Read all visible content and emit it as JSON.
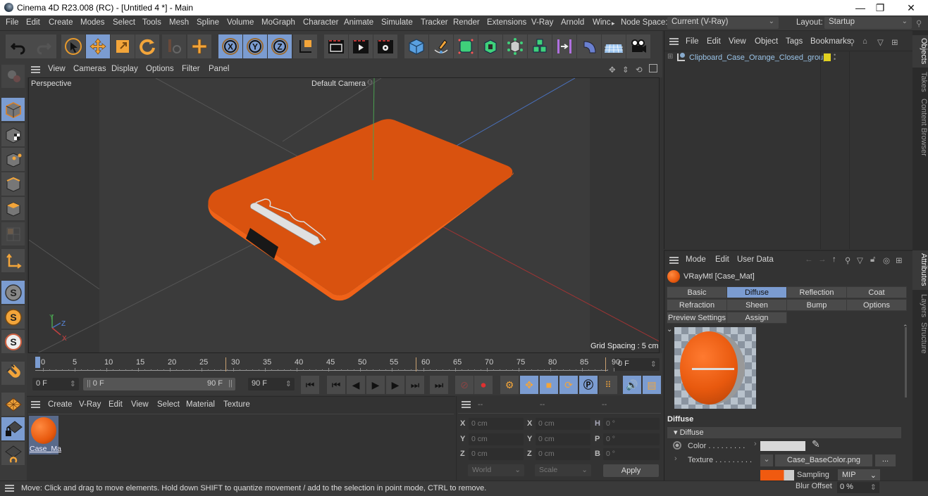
{
  "window": {
    "title": "Cinema 4D R23.008 (RC) - [Untitled 4 *] - Main",
    "minimize": "—",
    "restore": "❐",
    "close": "✕"
  },
  "menubar": {
    "items": [
      "File",
      "Edit",
      "Create",
      "Modes",
      "Select",
      "Tools",
      "Mesh",
      "Spline",
      "Volume",
      "MoGraph",
      "Character",
      "Animate",
      "Simulate",
      "Tracker",
      "Render",
      "Extensions",
      "V-Ray",
      "Arnold",
      "Winc"
    ],
    "more_arrow": "▸",
    "node_space_label": "Node Space:",
    "node_space_value": "Current (V-Ray)",
    "layout_label": "Layout:",
    "layout_value": "Startup"
  },
  "toolbar": {
    "icons": [
      "undo-icon",
      "redo-icon",
      "live-selection-icon",
      "move-icon",
      "scale-icon",
      "rotate-icon",
      "recent-tools-icon",
      "add-axis-icon",
      "x-axis-icon",
      "y-axis-icon",
      "z-axis-icon",
      "coordinate-system-icon",
      "render-view-icon",
      "render-to-picture-viewer-icon",
      "render-settings-icon",
      "cube-icon",
      "pen-spline-icon",
      "subdivision-surface-icon",
      "extrude-icon",
      "cloner-icon",
      "mograph-icon",
      "deformer-icon",
      "field-icon",
      "floor-icon",
      "camera-icon"
    ]
  },
  "viewport": {
    "menu": [
      "View",
      "Cameras",
      "Display",
      "Options",
      "Filter",
      "Panel"
    ],
    "view_name": "Perspective",
    "camera_name": "Default Camera",
    "grid_spacing": "Grid Spacing : 5 cm",
    "axis_labels": {
      "x": "X",
      "y": "Y",
      "z": "Z"
    },
    "object_color": "#E8590E"
  },
  "timeline": {
    "ticks": [
      "0",
      "5",
      "10",
      "15",
      "20",
      "25",
      "30",
      "35",
      "40",
      "45",
      "50",
      "55",
      "60",
      "65",
      "70",
      "75",
      "80",
      "85",
      "90"
    ],
    "current_frame": "0 F",
    "start_frame": "0 F",
    "range_start": "0 F",
    "range_end": "90 F",
    "end_frame": "90 F",
    "playhead_frame": "0 F"
  },
  "material_manager": {
    "menu": [
      "Create",
      "V-Ray",
      "Edit",
      "View",
      "Select",
      "Material",
      "Texture"
    ],
    "materials": [
      {
        "name": "Case_Ma",
        "color": "#E8590E"
      }
    ]
  },
  "coordinates": {
    "headers": [
      "--",
      "--",
      "--"
    ],
    "rows": [
      {
        "pos_label": "X",
        "pos": "0 cm",
        "size_label": "X",
        "size": "0 cm",
        "rot_label": "H",
        "rot": "0 °"
      },
      {
        "pos_label": "Y",
        "pos": "0 cm",
        "size_label": "Y",
        "size": "0 cm",
        "rot_label": "P",
        "rot": "0 °"
      },
      {
        "pos_label": "Z",
        "pos": "0 cm",
        "size_label": "Z",
        "size": "0 cm",
        "rot_label": "B",
        "rot": "0 °"
      }
    ],
    "mode_select": "World",
    "scale_select": "Scale",
    "apply_label": "Apply"
  },
  "object_manager": {
    "menu": [
      "File",
      "Edit",
      "View",
      "Object",
      "Tags",
      "Bookmarks"
    ],
    "objects": [
      {
        "name": "Clipboard_Case_Orange_Closed_group",
        "tag_color": "#E0D020"
      }
    ]
  },
  "attributes": {
    "menu": [
      "Mode",
      "Edit",
      "User Data"
    ],
    "material_title": "VRayMtl [Case_Mat]",
    "tabs_row1": [
      "Basic",
      "Diffuse",
      "Reflection",
      "Coat"
    ],
    "tabs_row2": [
      "Refraction",
      "Sheen",
      "Bump",
      "Options"
    ],
    "tabs_row3": [
      "Preview Settings",
      "Assign"
    ],
    "active_tab": "Diffuse",
    "section_title": "Diffuse",
    "group_title": "▾ Diffuse",
    "color_label": "Color . . . . . . . . .",
    "color_value": "#D8D8D8",
    "texture_label": "Texture . . . . . . . . .",
    "texture_file": "Case_BaseColor.png",
    "texture_more": "...",
    "sampling_label": "Sampling",
    "sampling_value": "MIP",
    "blur_offset_label": "Blur Offset",
    "blur_offset_value": "0 %"
  },
  "side_tabs": {
    "top": [
      "Objects",
      "Takes",
      "Content Browser"
    ],
    "bottom": [
      "Attributes",
      "Layers",
      "Structure"
    ]
  },
  "status": {
    "message": "Move: Click and drag to move elements. Hold down SHIFT to quantize movement / add to the selection in point mode, CTRL to remove."
  }
}
